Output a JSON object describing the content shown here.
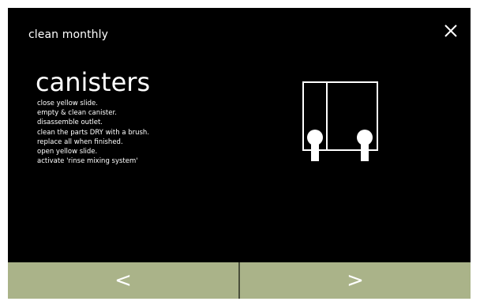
{
  "header": {
    "title": "clean monthly",
    "close_glyph": "✕",
    "close_icon": "close-icon"
  },
  "content": {
    "title": "canisters",
    "steps": [
      "close yellow slide.",
      "empty & clean canister.",
      "disassemble outlet.",
      "clean the parts DRY with a brush.",
      "replace all when finished.",
      "open yellow slide.",
      "activate 'rinse mixing system'"
    ],
    "illustration_icon": "canisters-icon"
  },
  "footer": {
    "prev_label": "<",
    "next_label": ">",
    "prev_icon": "chevron-left-icon",
    "next_icon": "chevron-right-icon"
  },
  "colors": {
    "screen_background": "#000000",
    "text": "#ffffff",
    "footer_background": "#aab389",
    "footer_divider": "#4a4f3b"
  }
}
